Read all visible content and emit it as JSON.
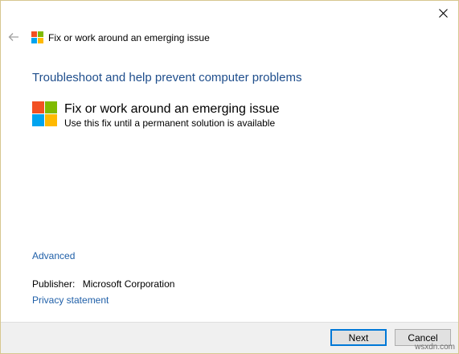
{
  "window": {
    "header_title": "Fix or work around an emerging issue"
  },
  "main": {
    "heading": "Troubleshoot and help prevent computer problems",
    "fix": {
      "title": "Fix or work around an emerging issue",
      "description": "Use this fix until a permanent solution is available"
    },
    "advanced_link": "Advanced",
    "publisher_label": "Publisher:",
    "publisher_value": "Microsoft Corporation",
    "privacy_link": "Privacy statement"
  },
  "footer": {
    "next_label": "Next",
    "cancel_label": "Cancel"
  },
  "watermark": "wsxdn.com",
  "icons": {
    "close": "close-icon",
    "back": "back-arrow-icon",
    "logo": "windows-logo-icon"
  },
  "colors": {
    "heading": "#1f4e8c",
    "link": "#1f5fa8",
    "logo_red": "#f25022",
    "logo_green": "#7fba00",
    "logo_blue": "#00a4ef",
    "logo_yellow": "#ffb900",
    "primary_border": "#0078d7"
  }
}
